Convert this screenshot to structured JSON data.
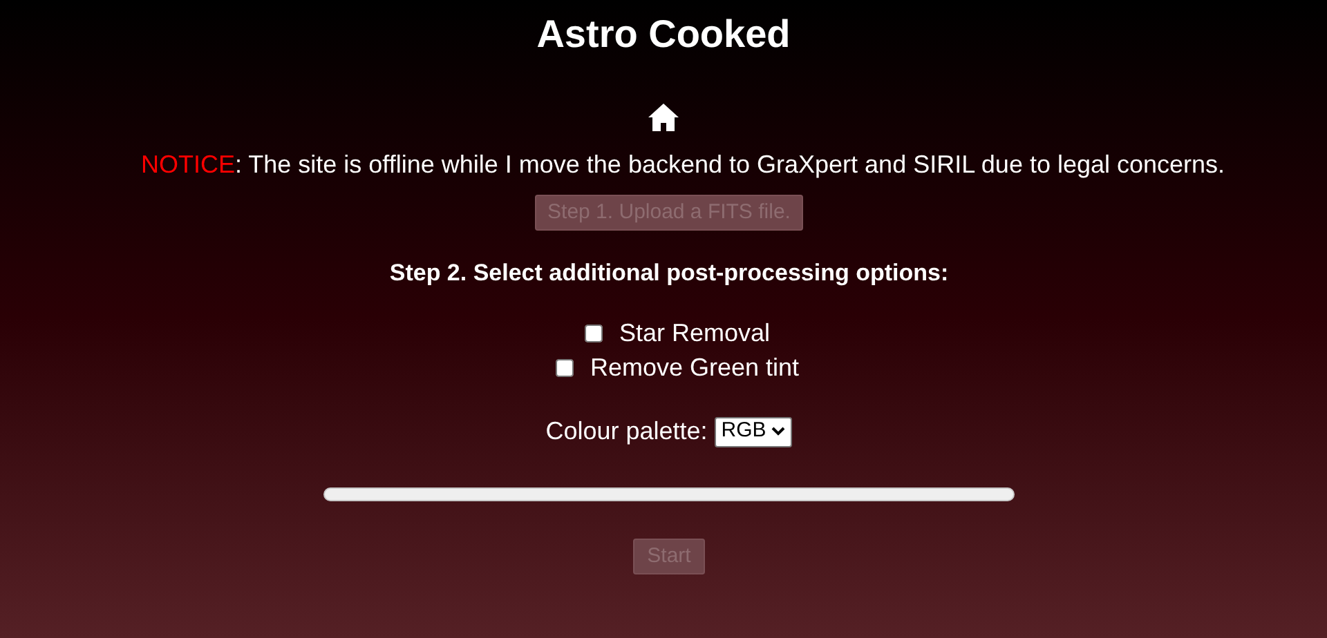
{
  "title": "Astro Cooked",
  "notice": {
    "label": "NOTICE",
    "text": ": The site is offline while I move the backend to GraXpert and SIRIL due to legal concerns."
  },
  "upload_button": {
    "label": "Step 1. Upload a FITS file.",
    "disabled": true
  },
  "step2_heading": "Step 2. Select additional post-processing options:",
  "options": [
    {
      "label": "Star Removal",
      "checked": false
    },
    {
      "label": "Remove Green tint",
      "checked": false
    }
  ],
  "palette": {
    "label": "Colour palette:",
    "value": "RGB"
  },
  "progress": {
    "level": 0
  },
  "start_button": {
    "label": "Start",
    "disabled": true
  }
}
